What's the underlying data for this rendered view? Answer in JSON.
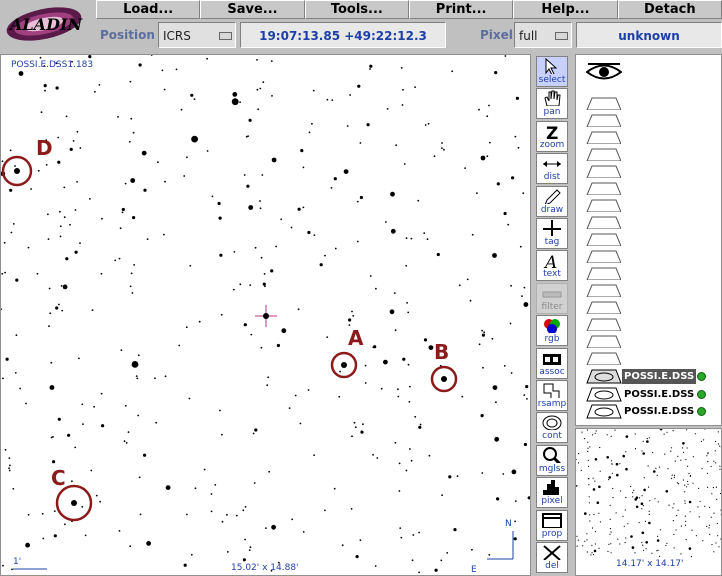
{
  "menu": [
    "Load...",
    "Save...",
    "Tools...",
    "Print...",
    "Help...",
    "Detach"
  ],
  "logo_text": "ALADIN",
  "locbar": {
    "position_label": "Position",
    "frame_value": "ICRS",
    "coordinates": "19:07:13.85 +49:22:12.3",
    "pixel_label": "Pixel",
    "pixel_mode": "full",
    "pixel_value": "unknown"
  },
  "view": {
    "image_name": "POSSI.E.DSS1.183",
    "scale_label": "1'",
    "fov": "15.02' x 14.88'",
    "north": "N",
    "east": "E",
    "markers": [
      "A",
      "B",
      "C",
      "D"
    ]
  },
  "tools": [
    {
      "label": "select",
      "icon": "arrow-icon"
    },
    {
      "label": "pan",
      "icon": "hand-icon"
    },
    {
      "label": "zoom",
      "icon": "zoom-icon"
    },
    {
      "label": "dist",
      "icon": "distance-icon"
    },
    {
      "label": "draw",
      "icon": "pencil-icon"
    },
    {
      "label": "tag",
      "icon": "crosshair-icon"
    },
    {
      "label": "text",
      "icon": "text-icon"
    },
    {
      "label": "filter",
      "icon": "filter-icon"
    },
    {
      "label": "rgb",
      "icon": "rgb-icon"
    },
    {
      "label": "assoc",
      "icon": "film-icon"
    },
    {
      "label": "rsamp",
      "icon": "resample-icon"
    },
    {
      "label": "cont",
      "icon": "contour-icon"
    },
    {
      "label": "mglss",
      "icon": "magnifier-icon"
    },
    {
      "label": "pixel",
      "icon": "histogram-icon"
    },
    {
      "label": "prop",
      "icon": "properties-icon"
    },
    {
      "label": "del",
      "icon": "delete-icon"
    }
  ],
  "layers": [
    "POSSI.E.DSS",
    "POSSI.E.DSS",
    "POSSI.E.DSS"
  ],
  "preview": {
    "fov": "14.17' x 14.17'"
  }
}
